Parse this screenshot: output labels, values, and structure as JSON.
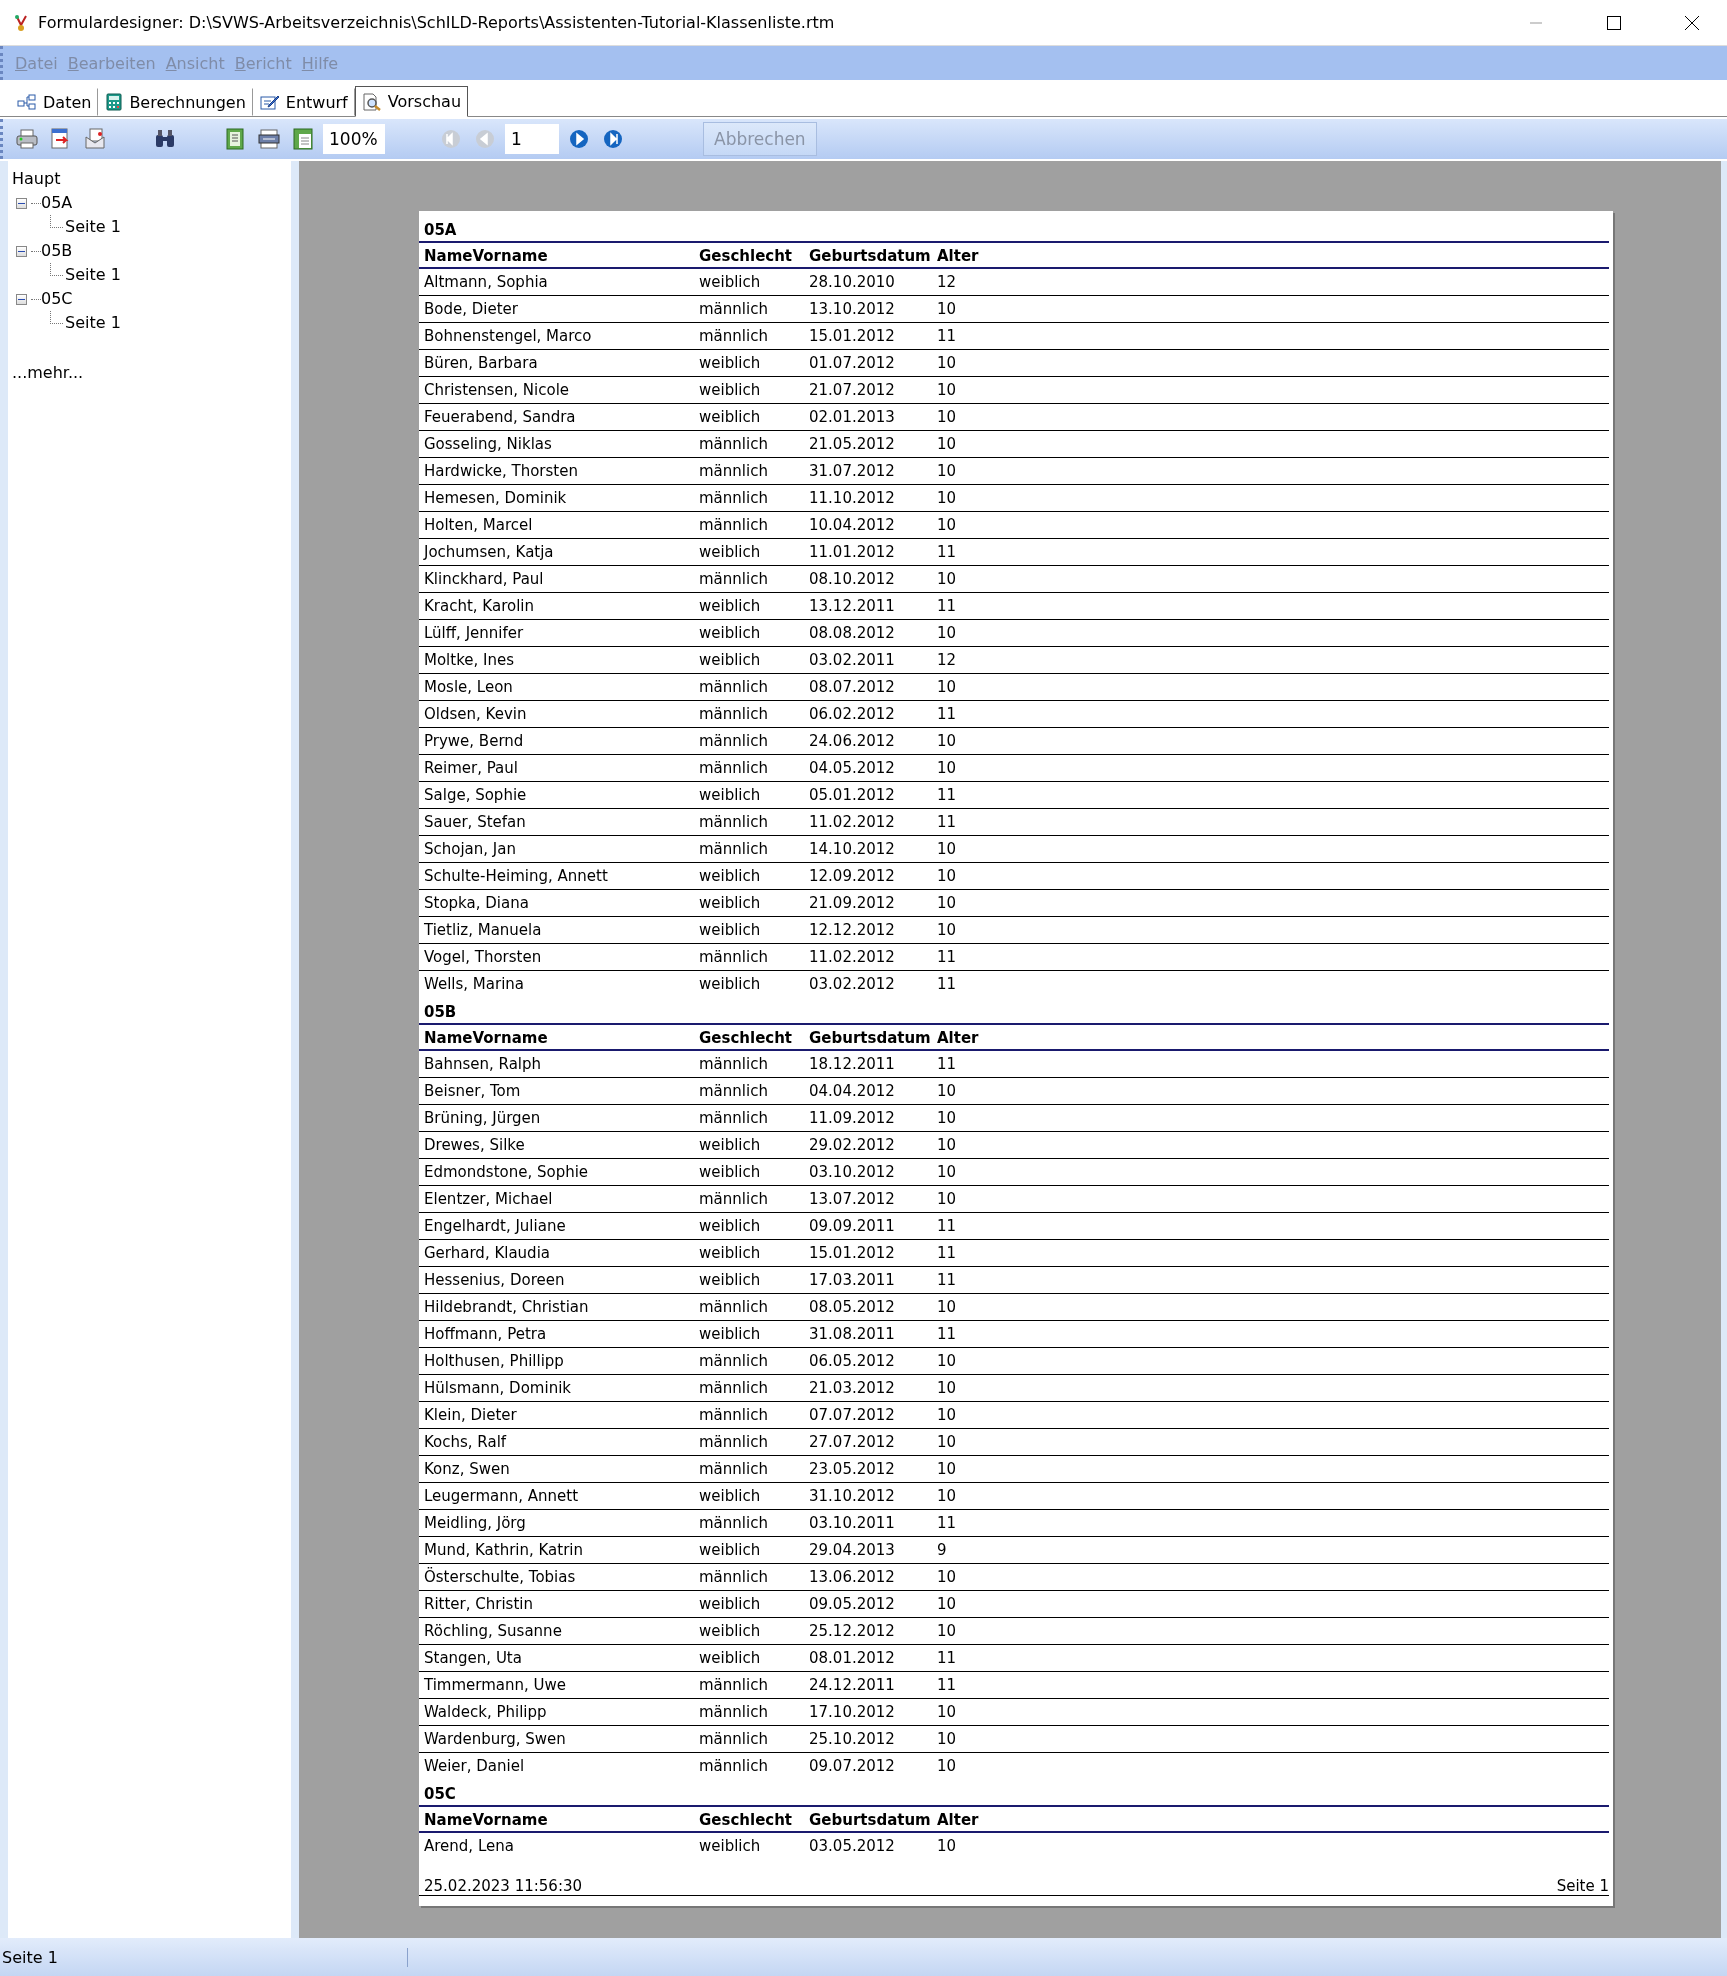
{
  "window": {
    "title": "Formulardesigner: D:\\SVWS-Arbeitsverzeichnis\\SchILD-Reports\\Assistenten-Tutorial-Klassenliste.rtm"
  },
  "menu": [
    {
      "label": "Datei",
      "disabled": true
    },
    {
      "label": "Bearbeiten",
      "disabled": true
    },
    {
      "label": "Ansicht",
      "disabled": true
    },
    {
      "label": "Bericht",
      "disabled": true
    },
    {
      "label": "Hilfe",
      "disabled": true
    }
  ],
  "tabs": [
    {
      "kind": "data",
      "label": "Daten",
      "selected": false
    },
    {
      "kind": "calc",
      "label": "Berechnungen",
      "selected": false
    },
    {
      "kind": "design",
      "label": "Entwurf",
      "selected": false
    },
    {
      "kind": "preview",
      "label": "Vorschau",
      "selected": true
    }
  ],
  "toolbar": {
    "zoom": "100%",
    "page": "1",
    "nav": [
      {
        "kind": "first",
        "disabled": true
      },
      {
        "kind": "prev",
        "disabled": true
      },
      {
        "kind": "next",
        "disabled": false
      },
      {
        "kind": "last",
        "disabled": false
      }
    ],
    "cancel": {
      "label": "Abbrechen",
      "disabled": true
    }
  },
  "tree": {
    "label": "Haupt",
    "children": [
      {
        "label": "05A",
        "expanded": true,
        "children": [
          {
            "label": "Seite 1"
          }
        ]
      },
      {
        "label": "05B",
        "expanded": true,
        "children": [
          {
            "label": "Seite 1"
          }
        ]
      },
      {
        "label": "05C",
        "expanded": true,
        "children": [
          {
            "label": "Seite 1"
          }
        ]
      }
    ],
    "more": "...mehr..."
  },
  "report": {
    "groups": [
      {
        "title": "05A",
        "columns": [
          "NameVorname",
          "Geschlecht",
          "Geburtsdatum",
          "Alter"
        ],
        "rows": [
          [
            "Altmann, Sophia",
            "weiblich",
            "28.10.2010",
            "12"
          ],
          [
            "Bode, Dieter",
            "männlich",
            "13.10.2012",
            "10"
          ],
          [
            "Bohnenstengel, Marco",
            "männlich",
            "15.01.2012",
            "11"
          ],
          [
            "Büren, Barbara",
            "weiblich",
            "01.07.2012",
            "10"
          ],
          [
            "Christensen, Nicole",
            "weiblich",
            "21.07.2012",
            "10"
          ],
          [
            "Feuerabend, Sandra",
            "weiblich",
            "02.01.2013",
            "10"
          ],
          [
            "Gosseling, Niklas",
            "männlich",
            "21.05.2012",
            "10"
          ],
          [
            "Hardwicke, Thorsten",
            "männlich",
            "31.07.2012",
            "10"
          ],
          [
            "Hemesen, Dominik",
            "männlich",
            "11.10.2012",
            "10"
          ],
          [
            "Holten, Marcel",
            "männlich",
            "10.04.2012",
            "10"
          ],
          [
            "Jochumsen, Katja",
            "weiblich",
            "11.01.2012",
            "11"
          ],
          [
            "Klinckhard, Paul",
            "männlich",
            "08.10.2012",
            "10"
          ],
          [
            "Kracht, Karolin",
            "weiblich",
            "13.12.2011",
            "11"
          ],
          [
            "Lülff, Jennifer",
            "weiblich",
            "08.08.2012",
            "10"
          ],
          [
            "Moltke, Ines",
            "weiblich",
            "03.02.2011",
            "12"
          ],
          [
            "Mosle, Leon",
            "männlich",
            "08.07.2012",
            "10"
          ],
          [
            "Oldsen, Kevin",
            "männlich",
            "06.02.2012",
            "11"
          ],
          [
            "Prywe, Bernd",
            "männlich",
            "24.06.2012",
            "10"
          ],
          [
            "Reimer, Paul",
            "männlich",
            "04.05.2012",
            "10"
          ],
          [
            "Salge, Sophie",
            "weiblich",
            "05.01.2012",
            "11"
          ],
          [
            "Sauer, Stefan",
            "männlich",
            "11.02.2012",
            "11"
          ],
          [
            "Schojan, Jan",
            "männlich",
            "14.10.2012",
            "10"
          ],
          [
            "Schulte-Heiming, Annett",
            "weiblich",
            "12.09.2012",
            "10"
          ],
          [
            "Stopka, Diana",
            "weiblich",
            "21.09.2012",
            "10"
          ],
          [
            "Tietliz, Manuela",
            "weiblich",
            "12.12.2012",
            "10"
          ],
          [
            "Vogel, Thorsten",
            "männlich",
            "11.02.2012",
            "11"
          ],
          [
            "Wells, Marina",
            "weiblich",
            "03.02.2012",
            "11"
          ]
        ]
      },
      {
        "title": "05B",
        "columns": [
          "NameVorname",
          "Geschlecht",
          "Geburtsdatum",
          "Alter"
        ],
        "rows": [
          [
            "Bahnsen, Ralph",
            "männlich",
            "18.12.2011",
            "11"
          ],
          [
            "Beisner, Tom",
            "männlich",
            "04.04.2012",
            "10"
          ],
          [
            "Brüning, Jürgen",
            "männlich",
            "11.09.2012",
            "10"
          ],
          [
            "Drewes, Silke",
            "weiblich",
            "29.02.2012",
            "10"
          ],
          [
            "Edmondstone, Sophie",
            "weiblich",
            "03.10.2012",
            "10"
          ],
          [
            "Elentzer, Michael",
            "männlich",
            "13.07.2012",
            "10"
          ],
          [
            "Engelhardt, Juliane",
            "weiblich",
            "09.09.2011",
            "11"
          ],
          [
            "Gerhard, Klaudia",
            "weiblich",
            "15.01.2012",
            "11"
          ],
          [
            "Hessenius, Doreen",
            "weiblich",
            "17.03.2011",
            "11"
          ],
          [
            "Hildebrandt, Christian",
            "männlich",
            "08.05.2012",
            "10"
          ],
          [
            "Hoffmann, Petra",
            "weiblich",
            "31.08.2011",
            "11"
          ],
          [
            "Holthusen, Phillipp",
            "männlich",
            "06.05.2012",
            "10"
          ],
          [
            "Hülsmann, Dominik",
            "männlich",
            "21.03.2012",
            "10"
          ],
          [
            "Klein, Dieter",
            "männlich",
            "07.07.2012",
            "10"
          ],
          [
            "Kochs, Ralf",
            "männlich",
            "27.07.2012",
            "10"
          ],
          [
            "Konz, Swen",
            "männlich",
            "23.05.2012",
            "10"
          ],
          [
            "Leugermann, Annett",
            "weiblich",
            "31.10.2012",
            "10"
          ],
          [
            "Meidling, Jörg",
            "männlich",
            "03.10.2011",
            "11"
          ],
          [
            "Mund, Kathrin, Katrin",
            "weiblich",
            "29.04.2013",
            "9"
          ],
          [
            "Österschulte, Tobias",
            "männlich",
            "13.06.2012",
            "10"
          ],
          [
            "Ritter, Christin",
            "weiblich",
            "09.05.2012",
            "10"
          ],
          [
            "Röchling, Susanne",
            "weiblich",
            "25.12.2012",
            "10"
          ],
          [
            "Stangen, Uta",
            "weiblich",
            "08.01.2012",
            "11"
          ],
          [
            "Timmermann, Uwe",
            "männlich",
            "24.12.2011",
            "11"
          ],
          [
            "Waldeck, Philipp",
            "männlich",
            "17.10.2012",
            "10"
          ],
          [
            "Wardenburg, Swen",
            "männlich",
            "25.10.2012",
            "10"
          ],
          [
            "Weier, Daniel",
            "männlich",
            "09.07.2012",
            "10"
          ]
        ]
      },
      {
        "title": "05C",
        "columns": [
          "NameVorname",
          "Geschlecht",
          "Geburtsdatum",
          "Alter"
        ],
        "rows": [
          [
            "Arend, Lena",
            "weiblich",
            "03.05.2012",
            "10"
          ]
        ]
      }
    ],
    "footer": {
      "date": "25.02.2023 11:56:30",
      "page": "Seite 1"
    }
  },
  "status_bar": {
    "text": "Seite 1"
  }
}
